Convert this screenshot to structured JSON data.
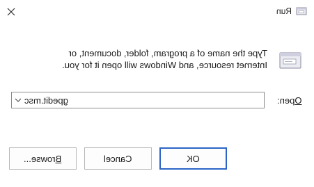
{
  "window": {
    "title": "Run"
  },
  "icons": {
    "close": "close-icon",
    "title": "run-icon",
    "main": "run-icon"
  },
  "description": {
    "line1": "Type the name of a program, folder, document, or",
    "line2": "Internet resource, and Windows will open it for you."
  },
  "open_field": {
    "label": "Open:",
    "label_access_key": "O",
    "label_rest": "pen:",
    "value": "gpedit.msc"
  },
  "buttons": {
    "ok": "OK",
    "cancel": "Cancel",
    "browse_access_key": "B",
    "browse_rest": "rowse..."
  },
  "colors": {
    "default_button_border": "#2b64c6"
  }
}
